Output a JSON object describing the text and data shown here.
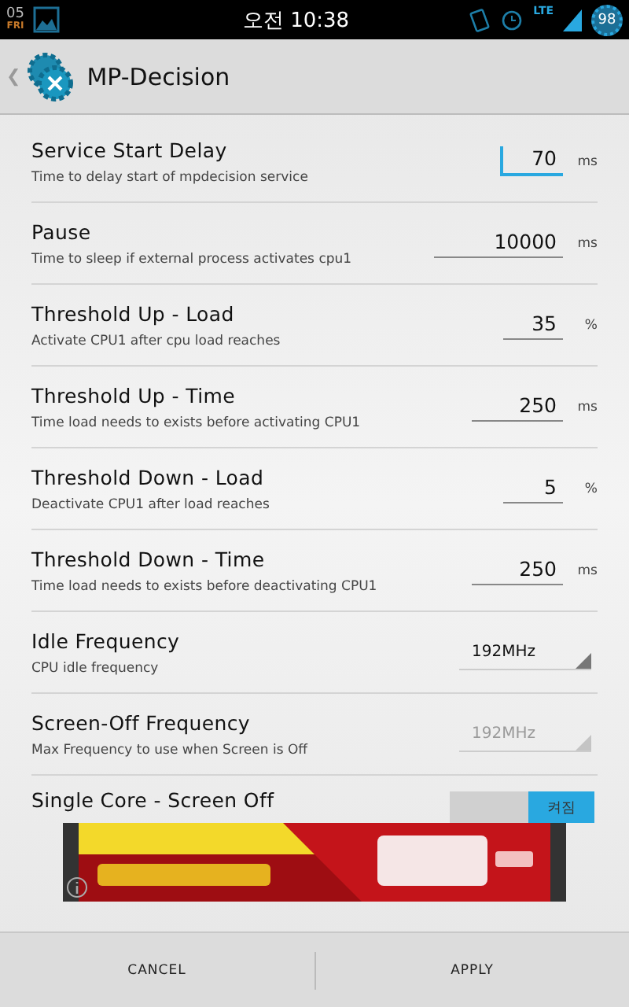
{
  "status_bar": {
    "date": "05",
    "weekday": "FRI",
    "time": "오전 10:38",
    "network": "LTE",
    "battery": "98"
  },
  "action_bar": {
    "back": "❮",
    "title": "MP-Decision"
  },
  "settings": [
    {
      "kind": "number",
      "title": "Service Start Delay",
      "description": "Time to delay start of mpdecision service",
      "value": "70",
      "unit": "ms",
      "focused": true
    },
    {
      "kind": "number",
      "title": "Pause",
      "description": "Time to sleep if external process activates cpu1",
      "value": "10000",
      "unit": "ms",
      "focused": false
    },
    {
      "kind": "number",
      "title": "Threshold Up - Load",
      "description": "Activate CPU1 after cpu load reaches",
      "value": "35",
      "unit": "%",
      "focused": false
    },
    {
      "kind": "number",
      "title": "Threshold Up - Time",
      "description": "Time load needs to exists before activating CPU1",
      "value": "250",
      "unit": "ms",
      "focused": false
    },
    {
      "kind": "number",
      "title": "Threshold Down - Load",
      "description": "Deactivate CPU1 after load reaches",
      "value": "5",
      "unit": "%",
      "focused": false
    },
    {
      "kind": "number",
      "title": "Threshold Down - Time",
      "description": "Time load needs to exists before deactivating CPU1",
      "value": "250",
      "unit": "ms",
      "focused": false
    },
    {
      "kind": "dropdown",
      "title": "Idle Frequency",
      "description": "CPU idle frequency",
      "value": "192MHz",
      "disabled": false
    },
    {
      "kind": "dropdown",
      "title": "Screen-Off Frequency",
      "description": "Max Frequency to use when Screen is Off",
      "value": "192MHz",
      "disabled": true
    },
    {
      "kind": "toggle",
      "title": "Single Core - Screen Off",
      "value": "켜짐",
      "on": true
    }
  ],
  "buttons": [
    "CANCEL",
    "APPLY"
  ]
}
